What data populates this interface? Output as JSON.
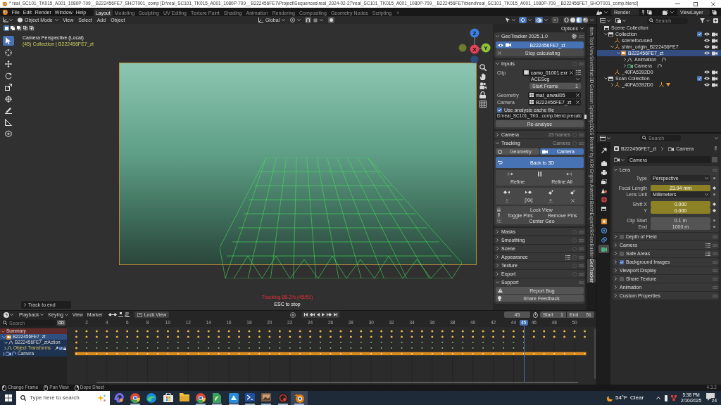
{
  "title_bar": {
    "title": "* real_SC101_TK015_A001_1080P-709__B222456FE7_SHOT001_comp [D:\\real_SC101_TK015_A001_1080P-709__B222456FE7\\Project\\Sequences\\real_2024-02-27\\real_SC101_TK015_A001_1080P-709__B222456FE7\\blend\\real_SC101_TK015_A001_1080P-709__B222456FE7_SHOT001_comp.blend]"
  },
  "top_bar": {
    "menus": [
      "File",
      "Edit",
      "Render",
      "Window",
      "Help"
    ],
    "workspaces": [
      {
        "label": "Layout",
        "selected": true
      },
      {
        "label": "Modeling",
        "selected": false
      },
      {
        "label": "Sculpting",
        "selected": false
      },
      {
        "label": "UV Editing",
        "selected": false
      },
      {
        "label": "Texture Paint",
        "selected": false
      },
      {
        "label": "Shading",
        "selected": false
      },
      {
        "label": "Animation",
        "selected": false
      },
      {
        "label": "Rendering",
        "selected": false
      },
      {
        "label": "Compositing",
        "selected": false
      },
      {
        "label": "Geometry Nodes",
        "selected": false
      },
      {
        "label": "Scripting",
        "selected": false
      }
    ],
    "add_workspace": "+",
    "scene": "Render",
    "view_layer": "ViewLayer"
  },
  "viewport_header": {
    "mode": "Object Mode",
    "menus": [
      "View",
      "Select",
      "Add",
      "Object"
    ],
    "orientation": "Global",
    "toggles": [
      {
        "kind": "gizmo",
        "on": true
      },
      {
        "kind": "overlay",
        "on": true
      },
      {
        "kind": "xray",
        "on": false
      }
    ],
    "shading": [
      {
        "kind": "wireframe",
        "selected": false
      },
      {
        "kind": "solid",
        "selected": false
      },
      {
        "kind": "material",
        "selected": true
      },
      {
        "kind": "rendered",
        "selected": false
      }
    ]
  },
  "viewport": {
    "select_modes": [
      {
        "kind": "set",
        "selected": true
      },
      {
        "kind": "extend",
        "selected": false
      },
      {
        "kind": "subtract",
        "selected": false
      },
      {
        "kind": "invert",
        "selected": false
      },
      {
        "kind": "intersect",
        "selected": false
      }
    ],
    "tools": [
      {
        "kind": "select_box",
        "selected": true
      },
      {
        "kind": "cursor",
        "selected": false
      },
      {
        "kind": "move",
        "selected": false
      },
      {
        "kind": "rotate",
        "selected": false
      },
      {
        "kind": "scale",
        "selected": false
      },
      {
        "kind": "transform",
        "selected": false
      },
      {
        "kind": "annotate",
        "selected": false
      },
      {
        "kind": "measure",
        "selected": false
      },
      {
        "kind": "add_cube",
        "selected": false
      }
    ],
    "camera_label": "Camera Perspective (Local)",
    "collection_label": "(45) Collection | B222456FE7_zt",
    "gizmo_axes": [
      "Z",
      "X",
      "Y"
    ],
    "progress": "Tracking 88.2% (45/51)",
    "progress_hint": "ESC to stop",
    "last_operator": "Track to end"
  },
  "sidebar": {
    "options": "Options",
    "tabs": [
      {
        "label": "Item",
        "selected": false
      },
      {
        "label": "Tool",
        "selected": false
      },
      {
        "label": "View",
        "selected": false
      },
      {
        "label": "Sketchfab",
        "selected": false
      },
      {
        "label": "3D Gaussian Splatting",
        "selected": false
      },
      {
        "label": "3DGS Render by KIRI Engine",
        "selected": false
      },
      {
        "label": "Autorbit",
        "selected": false
      },
      {
        "label": "BatchExport",
        "selected": false
      },
      {
        "label": "VR",
        "selected": false
      },
      {
        "label": "FaceBuilder",
        "selected": false
      },
      {
        "label": "GeoTracker",
        "selected": true
      }
    ],
    "geotracker": {
      "title": "GeoTracker 2025.1.0",
      "expanded": true,
      "target": "B222456FE7_zt",
      "stop": "Stop calculating"
    },
    "inputs": {
      "title": "Inputs",
      "expanded": true,
      "clip_label": "Clip",
      "clip": "camo_01001.exr",
      "colorspace": "ACEScg",
      "start_frame_label": "Start Frame",
      "start_frame": "1",
      "geometry_label": "Geometry",
      "geometry": "mat_arwall05",
      "camera_label": "Camera",
      "camera": "B222456FE7_zt",
      "use_cache": {
        "label": "Use analysis cache file",
        "checked": true
      },
      "cache_path": "D:\\real_SC101_TK0...comp.blend.precalc",
      "reanalyse": "Re-analyse"
    },
    "camera": {
      "title": "Camera",
      "expanded": false,
      "hint": "23 frames"
    },
    "tracking": {
      "title": "Tracking",
      "expanded": true,
      "hint": "Camera",
      "modes": [
        {
          "label": "Geometry",
          "selected": false
        },
        {
          "label": "Camera",
          "selected": true
        }
      ],
      "back": "Back to 3D",
      "refine": "Refine",
      "refine_all": "Refine All",
      "clear_keys": "[Xk]",
      "lock_view": "Lock View",
      "toggle_pins": "Toggle Pins",
      "remove_pins": "Remove Pins",
      "center_geo": "Center Geo"
    },
    "panels": [
      {
        "title": "Masks",
        "expanded": false,
        "presets": false
      },
      {
        "title": "Smoothing",
        "expanded": false,
        "presets": false
      },
      {
        "title": "Scene",
        "expanded": false,
        "presets": false
      },
      {
        "title": "Appearance",
        "expanded": false,
        "presets": true
      },
      {
        "title": "Texture",
        "expanded": false,
        "presets": false
      },
      {
        "title": "Export",
        "expanded": false,
        "presets": false
      }
    ],
    "support": {
      "title": "Support",
      "expanded": true,
      "report": "Report Bug",
      "feedback": "Share Feedback"
    }
  },
  "outliner": {
    "search_placeholder": "Search",
    "tree": [
      {
        "label": "Scene Collection",
        "kind": "scene",
        "selected": false,
        "children": [
          {
            "label": "Collection",
            "kind": "collection",
            "selected": false,
            "expanded": true,
            "children": [
              {
                "label": "scenefocused",
                "kind": "empty",
                "selected": false
              },
              {
                "label": "shim_origin_B222456FE7",
                "kind": "empty",
                "selected": false,
                "expanded": true,
                "children": [
                  {
                    "label": "B222456FE7_zt",
                    "kind": "camera",
                    "selected": true,
                    "expanded": true,
                    "children": [
                      {
                        "label": "Animation",
                        "kind": "animation",
                        "selected": false,
                        "expanded": false
                      },
                      {
                        "label": "Camera",
                        "kind": "camera_data",
                        "selected": false,
                        "expanded": false
                      }
                    ]
                  }
                ]
              },
              {
                "label": "_40FA5392D0",
                "kind": "empty",
                "selected": false
              }
            ]
          },
          {
            "label": "Scan Collection",
            "kind": "collection",
            "selected": false,
            "expanded": true,
            "children": [
              {
                "label": "_40FA5392D0",
                "kind": "empty_linked",
                "selected": false,
                "expanded": false
              }
            ]
          }
        ]
      }
    ]
  },
  "properties": {
    "search_placeholder": "Search",
    "tabs": [
      {
        "kind": "tool",
        "selected": false
      },
      {
        "kind": "render",
        "selected": false
      },
      {
        "kind": "output",
        "selected": false
      },
      {
        "kind": "view_layer",
        "selected": false
      },
      {
        "kind": "scene",
        "selected": false
      },
      {
        "kind": "world",
        "selected": false
      },
      {
        "kind": "collection",
        "selected": false
      },
      {
        "kind": "object",
        "selected": false
      },
      {
        "kind": "physics",
        "selected": false
      },
      {
        "kind": "constraints",
        "selected": false
      },
      {
        "kind": "data",
        "selected": true
      }
    ],
    "breadcrumb": [
      "B222456FE7_zt",
      "Camera"
    ],
    "datablock": "Camera",
    "lens": {
      "title": "Lens",
      "expanded": true,
      "rows": [
        {
          "label": "Type",
          "value": "Perspective",
          "kind": "dropdown",
          "keyed": false
        },
        {
          "label": "Focal Length",
          "value": "23.94 mm",
          "kind": "number",
          "keyed": true
        },
        {
          "label": "Lens Unit",
          "value": "Millimeters",
          "kind": "dropdown",
          "keyed": false
        },
        {
          "label": "Shift X",
          "value": "0.000",
          "kind": "number",
          "keyed": true
        },
        {
          "label": "Y",
          "value": "0.000",
          "kind": "number",
          "keyed": true
        },
        {
          "label": "Clip Start",
          "value": "0.1 m",
          "kind": "number",
          "keyed": false
        },
        {
          "label": "End",
          "value": "1000 m",
          "kind": "number",
          "keyed": false
        }
      ]
    },
    "panels": [
      {
        "title": "Depth of Field",
        "expanded": false,
        "enabled": false,
        "presets": false
      },
      {
        "title": "Camera",
        "expanded": false,
        "presets": true
      },
      {
        "title": "Safe Areas",
        "expanded": false,
        "enabled": false,
        "presets": true
      },
      {
        "title": "Background Images",
        "expanded": false,
        "enabled": true,
        "presets": false
      },
      {
        "title": "Viewport Display",
        "expanded": false,
        "presets": false
      },
      {
        "title": "Share Texture",
        "expanded": false,
        "enabled": false,
        "presets": false
      },
      {
        "title": "Animation",
        "expanded": false,
        "presets": false
      },
      {
        "title": "Custom Properties",
        "expanded": false,
        "presets": false
      }
    ]
  },
  "dopesheet": {
    "menus": [
      "Playback",
      "Keying",
      "View",
      "Marker"
    ],
    "lock_view": "Lock View",
    "current_frame": "45",
    "start_label": "Start",
    "start": "1",
    "end_label": "End",
    "end": "51",
    "search_placeholder": "Search",
    "ruler": [
      {
        "label": "2",
        "selected": false
      },
      {
        "label": "4",
        "selected": false
      },
      {
        "label": "6",
        "selected": false
      },
      {
        "label": "8",
        "selected": false
      },
      {
        "label": "10",
        "selected": false
      },
      {
        "label": "12",
        "selected": false
      },
      {
        "label": "14",
        "selected": false
      },
      {
        "label": "16",
        "selected": false
      },
      {
        "label": "18",
        "selected": false
      },
      {
        "label": "20",
        "selected": false
      },
      {
        "label": "22",
        "selected": false
      },
      {
        "label": "24",
        "selected": false
      },
      {
        "label": "26",
        "selected": false
      },
      {
        "label": "28",
        "selected": false
      },
      {
        "label": "30",
        "selected": false
      },
      {
        "label": "32",
        "selected": false
      },
      {
        "label": "34",
        "selected": false
      },
      {
        "label": "36",
        "selected": false
      },
      {
        "label": "38",
        "selected": false
      },
      {
        "label": "40",
        "selected": false
      },
      {
        "label": "42",
        "selected": false
      },
      {
        "label": "44",
        "selected": false
      },
      {
        "label": "45",
        "selected": true
      },
      {
        "label": "46",
        "selected": false
      },
      {
        "label": "48",
        "selected": false
      },
      {
        "label": "50",
        "selected": false
      }
    ],
    "channels": [
      {
        "label": "Summary",
        "kind": "summary",
        "expanded": true
      },
      {
        "label": "B222456FE7_zt",
        "kind": "object",
        "expanded": true
      },
      {
        "label": "B222456FE7_ztAction",
        "kind": "action",
        "expanded": true
      },
      {
        "label": "Object Transforms",
        "kind": "group",
        "expanded": false,
        "enabled": true
      },
      {
        "label": "Camera",
        "kind": "data",
        "expanded": false
      }
    ]
  },
  "status_bar": {
    "hints": [
      {
        "kind": "left",
        "label": "Change Frame"
      },
      {
        "kind": "middle",
        "label": "Pan View"
      },
      {
        "kind": "right",
        "label": "Dope Sheet"
      }
    ],
    "version": "4.3.2"
  },
  "taskbar": {
    "search_placeholder": "Type here to search",
    "apps": [
      {
        "kind": "swirl",
        "running": false,
        "selected": false
      },
      {
        "kind": "ring",
        "running": true,
        "selected": false
      },
      {
        "kind": "wave",
        "running": false,
        "selected": false
      },
      {
        "kind": "bag",
        "running": false,
        "selected": false
      },
      {
        "kind": "folder",
        "running": false,
        "selected": false
      },
      {
        "kind": "ring",
        "running": true,
        "selected": false
      },
      {
        "kind": "document",
        "running": true,
        "selected": false
      },
      {
        "kind": "tile",
        "running": true,
        "selected": false
      },
      {
        "kind": "terminal",
        "running": true,
        "selected": false
      },
      {
        "kind": "picture",
        "running": true,
        "selected": false
      },
      {
        "kind": "disc",
        "running": true,
        "selected": false
      },
      {
        "kind": "ring_dot",
        "running": true,
        "selected": true
      }
    ],
    "temperature": "54°F",
    "weather": "Clear",
    "time": "5:38 PM",
    "date": "2/10/2025",
    "notifications": "24"
  }
}
